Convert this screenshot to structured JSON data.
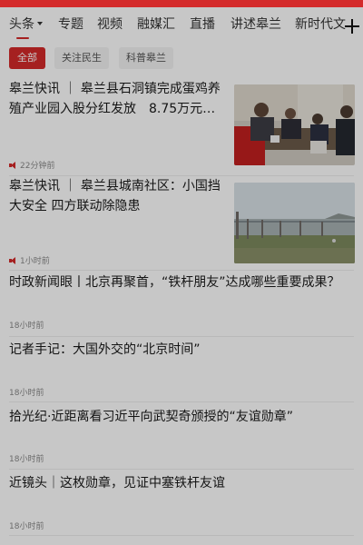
{
  "tabs": [
    {
      "label": "头条"
    },
    {
      "label": "专题"
    },
    {
      "label": "视频"
    },
    {
      "label": "融媒汇"
    },
    {
      "label": "直播"
    },
    {
      "label": "讲述皋兰"
    },
    {
      "label": "新时代文"
    }
  ],
  "chips": [
    {
      "label": "全部"
    },
    {
      "label": "关注民生"
    },
    {
      "label": "科普皋兰"
    }
  ],
  "articles": [
    {
      "title": "皋兰快讯 ｜ 皋兰县石洞镇完成蛋鸡养殖产业园入股分红发放　8.75万元…",
      "time": "22分钟前"
    },
    {
      "title": "皋兰快讯 ｜ 皋兰县城南社区：小国挡大安全 四方联动除隐患",
      "time": "1小时前"
    },
    {
      "title": "时政新闻眼丨北京再聚首，“铁杆朋友”达成哪些重要成果？",
      "time": "18小时前"
    },
    {
      "title": "记者手记：大国外交的“北京时间”",
      "time": "18小时前"
    },
    {
      "title": "拾光纪·近距离看习近平向武契奇颁授的“友谊勋章”",
      "time": "18小时前"
    },
    {
      "title": "近镜头｜这枚勋章，见证中塞铁杆友谊",
      "time": "18小时前"
    }
  ],
  "colors": {
    "accent": "#d42a2a"
  }
}
